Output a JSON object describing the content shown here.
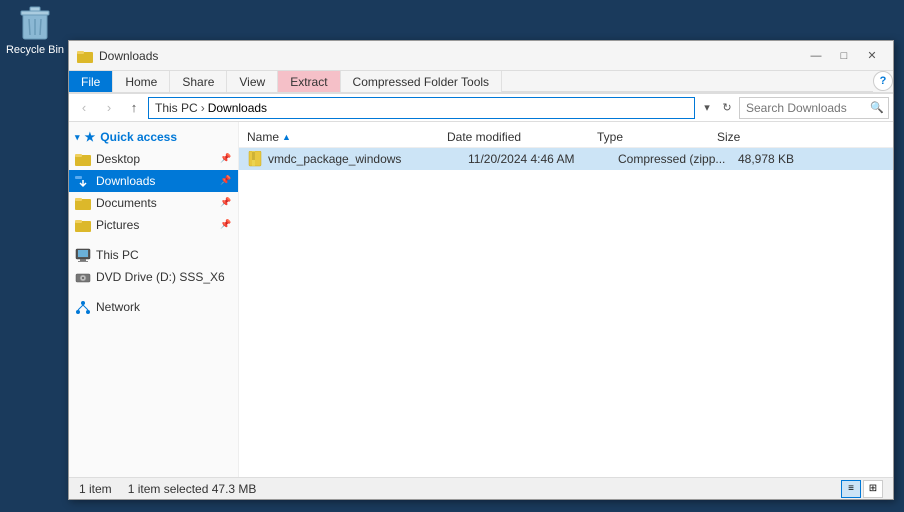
{
  "desktop": {
    "recycle_bin_label": "Recycle Bin"
  },
  "window": {
    "title": "Downloads",
    "title_icon": "folder"
  },
  "title_buttons": {
    "minimize": "—",
    "maximize": "□",
    "close": "✕"
  },
  "ribbon": {
    "tabs": [
      {
        "id": "file",
        "label": "File",
        "active": true
      },
      {
        "id": "home",
        "label": "Home"
      },
      {
        "id": "share",
        "label": "Share"
      },
      {
        "id": "view",
        "label": "View"
      },
      {
        "id": "extract",
        "label": "Extract",
        "highlight": true
      },
      {
        "id": "compressed",
        "label": "Compressed Folder Tools"
      }
    ],
    "help_label": "?"
  },
  "address_bar": {
    "back_btn": "‹",
    "forward_btn": "›",
    "up_btn": "↑",
    "path_parts": [
      "This PC",
      "Downloads"
    ],
    "dropdown_arrow": "▾",
    "refresh_icon": "↻",
    "search_placeholder": "Search Downloads",
    "search_icon": "🔍"
  },
  "sidebar": {
    "sections": [
      {
        "id": "quick-access",
        "header": "Quick access",
        "items": [
          {
            "id": "desktop",
            "label": "Desktop",
            "icon": "folder",
            "pinned": true
          },
          {
            "id": "downloads",
            "label": "Downloads",
            "icon": "down-folder",
            "pinned": true,
            "active": true
          },
          {
            "id": "documents",
            "label": "Documents",
            "icon": "folder",
            "pinned": true
          },
          {
            "id": "pictures",
            "label": "Pictures",
            "icon": "folder",
            "pinned": true
          }
        ]
      },
      {
        "id": "this-pc",
        "header": null,
        "items": [
          {
            "id": "thispc",
            "label": "This PC",
            "icon": "pc"
          }
        ]
      },
      {
        "id": "dvd",
        "header": null,
        "items": [
          {
            "id": "dvd",
            "label": "DVD Drive (D:) SSS_X6",
            "icon": "dvd"
          }
        ]
      },
      {
        "id": "network",
        "header": null,
        "items": [
          {
            "id": "network",
            "label": "Network",
            "icon": "network"
          }
        ]
      }
    ]
  },
  "file_list": {
    "columns": [
      {
        "id": "name",
        "label": "Name",
        "sort": "up"
      },
      {
        "id": "date",
        "label": "Date modified"
      },
      {
        "id": "type",
        "label": "Type"
      },
      {
        "id": "size",
        "label": "Size"
      }
    ],
    "files": [
      {
        "name": "vmdc_package_windows",
        "date": "11/20/2024 4:46 AM",
        "type": "Compressed (zipp...",
        "size": "48,978 KB",
        "icon": "zip",
        "selected": true
      }
    ]
  },
  "status_bar": {
    "item_count": "1 item",
    "selected_info": "1 item selected  47.3 MB"
  }
}
